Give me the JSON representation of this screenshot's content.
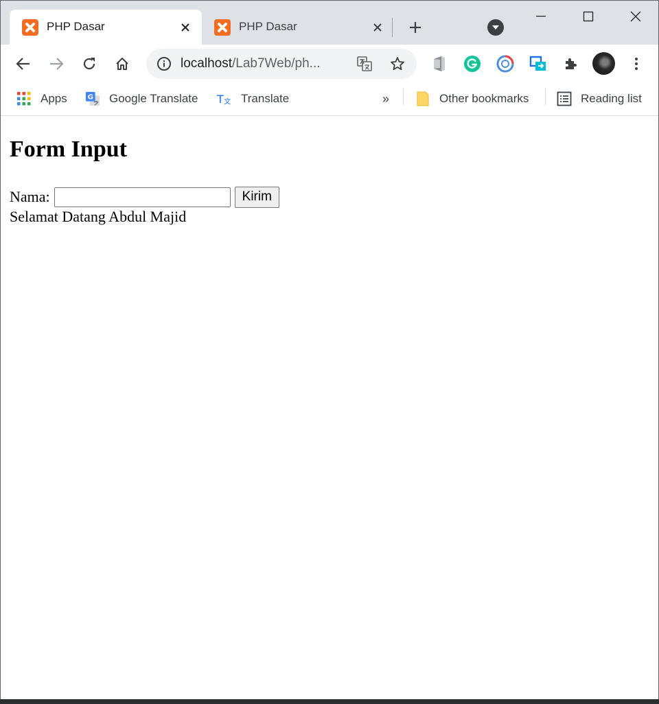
{
  "tabs": [
    {
      "title": "PHP Dasar",
      "active": true,
      "favicon": "xampp-icon"
    },
    {
      "title": "PHP Dasar",
      "active": false,
      "favicon": "xampp-icon"
    }
  ],
  "address_bar": {
    "host": "localhost",
    "path": "/Lab7Web/ph..."
  },
  "bookmarks": {
    "items": [
      {
        "label": "Apps",
        "icon": "apps-grid-icon"
      },
      {
        "label": "Google Translate",
        "icon": "google-translate-icon"
      },
      {
        "label": "Translate",
        "icon": "translate-icon"
      }
    ],
    "overflow": "»",
    "other_label": "Other bookmarks",
    "reading_list_label": "Reading list"
  },
  "page": {
    "heading": "Form Input",
    "field_label": "Nama:",
    "field_value": "",
    "submit_label": "Kirim",
    "greeting": "Selamat Datang Abdul Majid"
  },
  "colors": {
    "tabstrip": "#dee1e6",
    "favicon": "#f26d21",
    "omnibox": "#f1f3f4"
  }
}
